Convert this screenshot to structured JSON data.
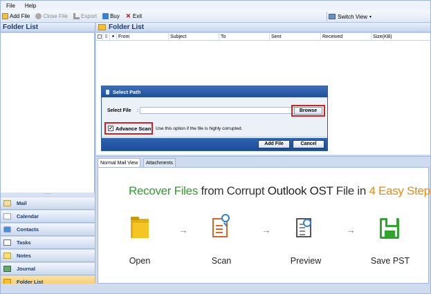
{
  "menu": {
    "file": "File",
    "help": "Help"
  },
  "toolbar": {
    "add_file": "Add File",
    "close_file": "Close File",
    "export": "Export",
    "buy": "Buy",
    "exit": "Exit",
    "switch_view": "Switch View"
  },
  "left_panel": {
    "title": "Folder List",
    "nav": [
      "Mail",
      "Calendar",
      "Contacts",
      "Tasks",
      "Notes",
      "Journal",
      "Folder List"
    ],
    "active": "Folder List"
  },
  "right_panel": {
    "title": "Folder List",
    "columns": [
      "From",
      "Subject",
      "To",
      "Sent",
      "Received",
      "Size(KB)"
    ]
  },
  "dialog": {
    "title": "Select Path",
    "select_file_label": "Select File",
    "colon": ":",
    "file_value": "",
    "browse": "Browse",
    "advance_scan": "Advance Scan",
    "advance_scan_checked": true,
    "check_mark": "✓",
    "hint": "Use this option if the file is highly corrupted.",
    "add_file": "Add File",
    "cancel": "Cancel"
  },
  "tabs": {
    "normal": "Normal Mail View",
    "attachments": "Attachments"
  },
  "preview": {
    "title_parts": [
      "Recover Files ",
      "from Corrupt ",
      "Outlook OST ",
      "File in ",
      "4 Easy Steps"
    ],
    "steps": [
      "Open",
      "Scan",
      "Preview",
      "Save PST"
    ],
    "arrow": "→"
  }
}
